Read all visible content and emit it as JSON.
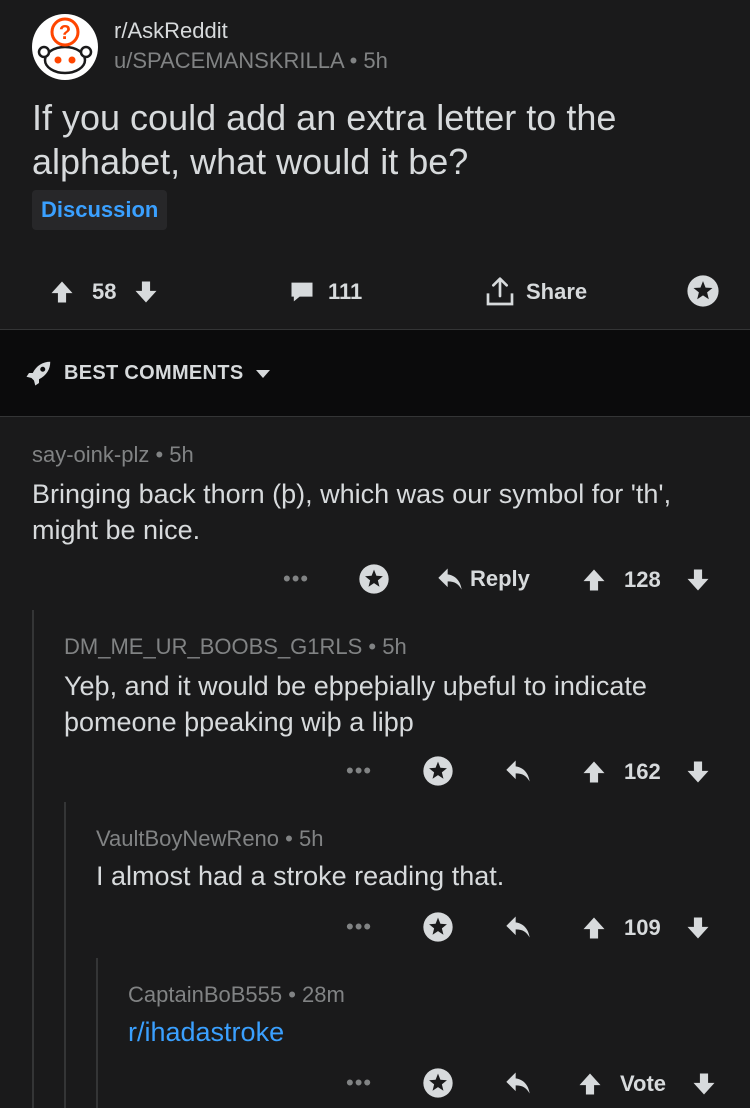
{
  "post": {
    "subreddit": "r/AskReddit",
    "author_line": "u/SPACEMANSKRILLA • 5h",
    "title": "If you could add an extra letter to the alphabet, what would it be?",
    "flair": "Discussion",
    "score": "58",
    "comment_count": "111",
    "share_label": "Share"
  },
  "sort": {
    "label": "BEST COMMENTS"
  },
  "comments": [
    {
      "meta": "say-oink-plz • 5h",
      "body": "Bringing back thorn (þ), which was our symbol for 'th',  might be nice.",
      "reply_label": "Reply",
      "score": "128"
    },
    {
      "meta": "DM_ME_UR_BOOBS_G1RLS • 5h",
      "body": "Yeþ, and it would be eþpeþially uþeful to indicate þomeone þpeaking wiþ a liþp",
      "score": "162"
    },
    {
      "meta": "VaultBoyNewReno • 5h",
      "body": "I almost had a stroke reading that.",
      "score": "109"
    },
    {
      "meta": "CaptainBoB555 • 28m",
      "body": "r/ihadastroke",
      "score": "Vote"
    }
  ],
  "colors": {
    "background": "#1a1a1b",
    "text": "#d7dadc",
    "muted": "#818384",
    "link": "#3aa0ff"
  }
}
